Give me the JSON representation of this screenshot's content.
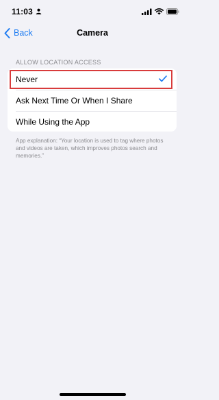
{
  "status_bar": {
    "time": "11:03",
    "icons": [
      "person-icon",
      "signal-icon",
      "wifi-icon",
      "battery-icon"
    ]
  },
  "nav": {
    "back_label": "Back",
    "title": "Camera"
  },
  "section": {
    "header": "ALLOW LOCATION ACCESS",
    "options": [
      {
        "label": "Never",
        "selected": true
      },
      {
        "label": "Ask Next Time Or When I Share",
        "selected": false
      },
      {
        "label": "While Using the App",
        "selected": false
      }
    ],
    "explanation": "App explanation: “Your location is used to tag where photos and videos are taken, which improves photos search and memories.”"
  },
  "colors": {
    "accent": "#1e7cf2",
    "highlight": "#d83b3b",
    "background": "#f2f2f7"
  }
}
